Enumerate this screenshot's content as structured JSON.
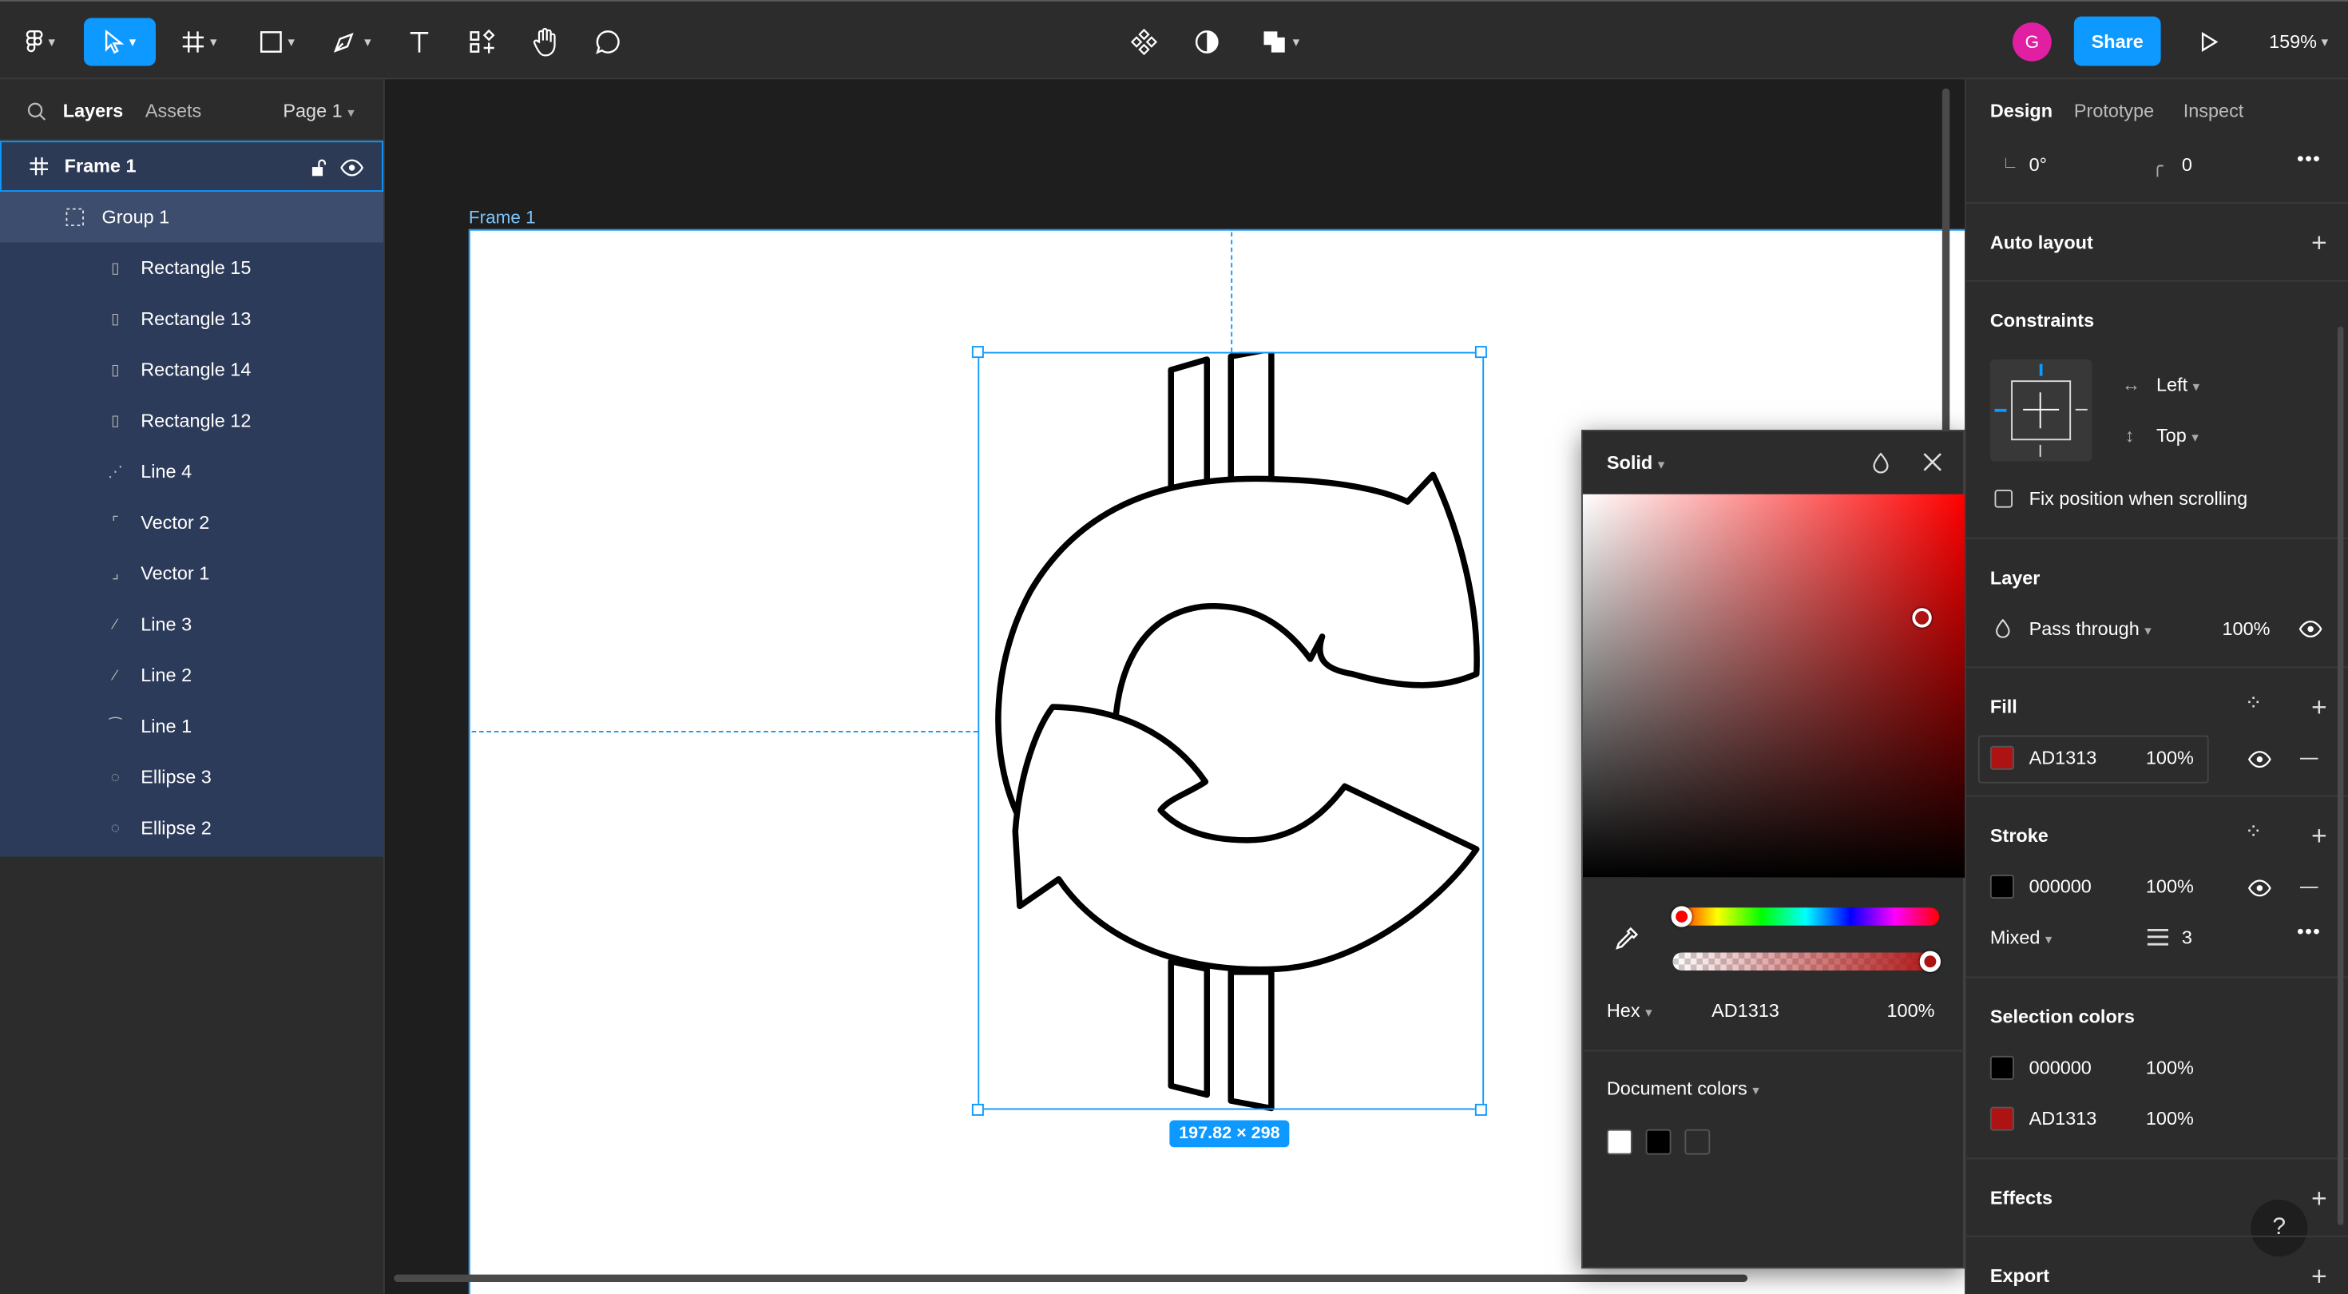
{
  "toolbar": {
    "zoom": "159%",
    "share_label": "Share",
    "avatar_initial": "G"
  },
  "left_panel": {
    "tabs": [
      "Layers",
      "Assets"
    ],
    "page": "Page 1",
    "layers": [
      {
        "name": "Frame 1",
        "icon": "frame-icon"
      },
      {
        "name": "Group 1",
        "icon": "group-icon"
      },
      {
        "name": "Rectangle 15",
        "icon": "rectangle-icon"
      },
      {
        "name": "Rectangle 13",
        "icon": "rectangle-icon"
      },
      {
        "name": "Rectangle 14",
        "icon": "rectangle-icon"
      },
      {
        "name": "Rectangle 12",
        "icon": "rectangle-icon"
      },
      {
        "name": "Line 4",
        "icon": "line-icon"
      },
      {
        "name": "Vector 2",
        "icon": "vector-icon"
      },
      {
        "name": "Vector 1",
        "icon": "vector-icon"
      },
      {
        "name": "Line 3",
        "icon": "line-icon"
      },
      {
        "name": "Line 2",
        "icon": "line-icon"
      },
      {
        "name": "Line 1",
        "icon": "line-icon"
      },
      {
        "name": "Ellipse 3",
        "icon": "ellipse-icon"
      },
      {
        "name": "Ellipse 2",
        "icon": "ellipse-icon"
      }
    ]
  },
  "canvas": {
    "frame_label": "Frame 1",
    "dimension_badge": "197.82 × 298"
  },
  "color_picker": {
    "mode": "Solid",
    "format": "Hex",
    "hex": "AD1313",
    "opacity": "100%",
    "document_colors_label": "Document colors",
    "document_colors": [
      "#ffffff",
      "#000000",
      "#2c2c2c"
    ],
    "colors": {
      "hue_start": "#ff0000",
      "selected": "#AD1313"
    }
  },
  "right_panel": {
    "tabs": [
      "Design",
      "Prototype",
      "Inspect"
    ],
    "rotation": "0°",
    "corner_radius": "0",
    "auto_layout_label": "Auto layout",
    "constraints_label": "Constraints",
    "constraint_h": "Left",
    "constraint_v": "Top",
    "fix_position_label": "Fix position when scrolling",
    "layer_label": "Layer",
    "blend_mode": "Pass through",
    "layer_opacity": "100%",
    "fill_label": "Fill",
    "fill": {
      "hex": "AD1313",
      "opacity": "100%",
      "color": "#AD1313"
    },
    "stroke_label": "Stroke",
    "stroke": {
      "hex": "000000",
      "opacity": "100%",
      "color": "#000000"
    },
    "stroke_position": "Mixed",
    "stroke_weight": "3",
    "selection_colors_label": "Selection colors",
    "selection_colors": [
      {
        "hex": "000000",
        "opacity": "100%",
        "color": "#000000"
      },
      {
        "hex": "AD1313",
        "opacity": "100%",
        "color": "#AD1313"
      }
    ],
    "effects_label": "Effects",
    "export_label": "Export",
    "help_label": "?"
  },
  "accent_color": "#0d99ff"
}
